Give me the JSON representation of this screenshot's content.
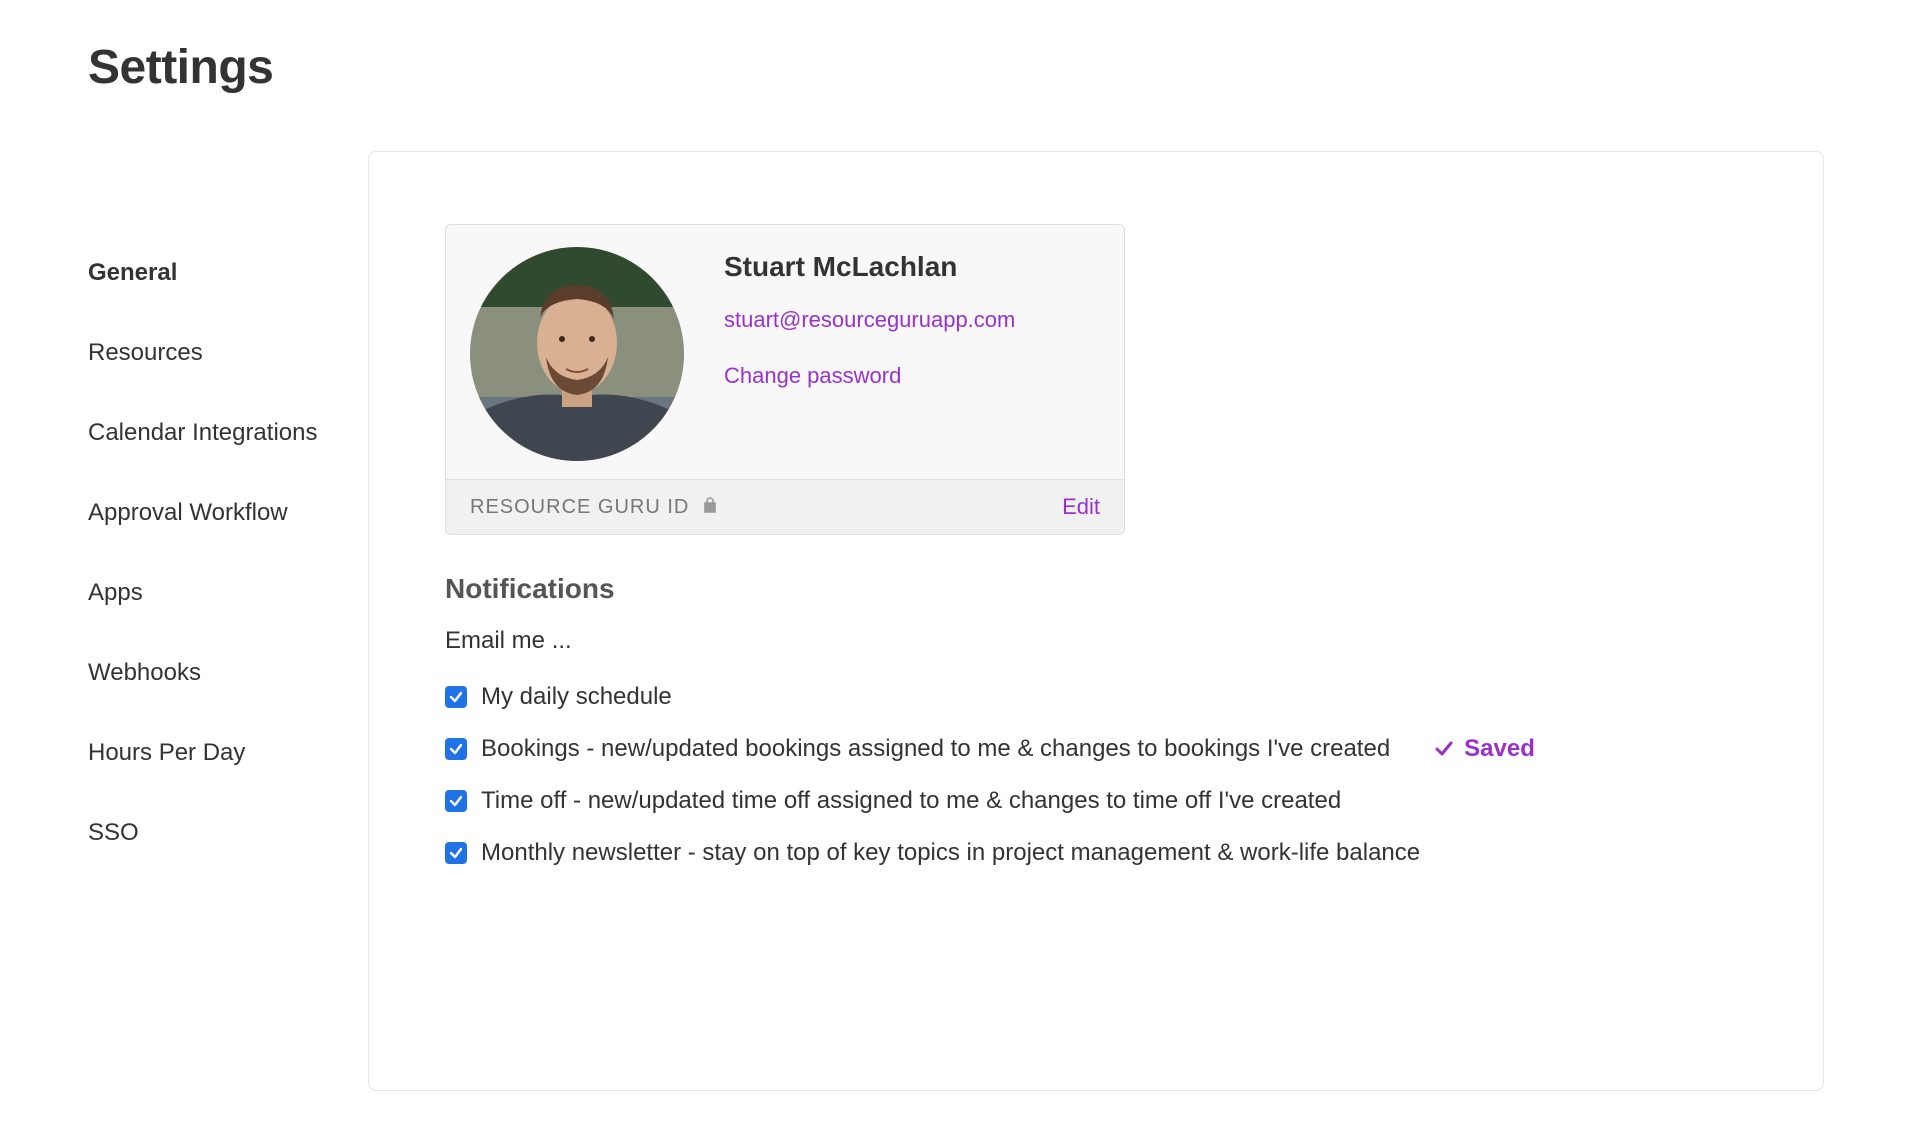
{
  "page": {
    "title": "Settings"
  },
  "sidebar": {
    "items": [
      {
        "label": "General",
        "active": true
      },
      {
        "label": "Resources",
        "active": false
      },
      {
        "label": "Calendar Integrations",
        "active": false
      },
      {
        "label": "Approval Workflow",
        "active": false
      },
      {
        "label": "Apps",
        "active": false
      },
      {
        "label": "Webhooks",
        "active": false
      },
      {
        "label": "Hours Per Day",
        "active": false
      },
      {
        "label": "SSO",
        "active": false
      }
    ]
  },
  "profile": {
    "name": "Stuart McLachlan",
    "email": "stuart@resourceguruapp.com",
    "change_password_label": "Change password",
    "id_label": "RESOURCE GURU ID",
    "edit_label": "Edit"
  },
  "notifications": {
    "heading": "Notifications",
    "subheading": "Email me ...",
    "items": [
      {
        "label": "My daily schedule",
        "checked": true
      },
      {
        "label": "Bookings - new/updated bookings assigned to me & changes to bookings I've created",
        "checked": true
      },
      {
        "label": "Time off - new/updated time off assigned to me & changes to time off I've created",
        "checked": true
      },
      {
        "label": "Monthly newsletter - stay on top of key topics in project management & work-life balance",
        "checked": true
      }
    ],
    "saved_label": "Saved"
  },
  "colors": {
    "accent": "#9932CC",
    "checkbox": "#1f73e6"
  }
}
